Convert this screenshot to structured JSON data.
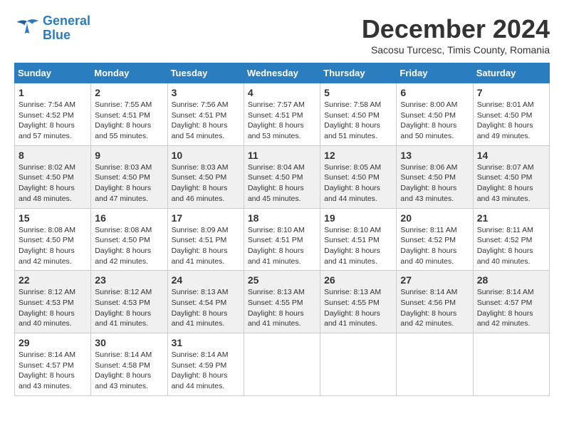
{
  "logo": {
    "line1": "General",
    "line2": "Blue"
  },
  "title": "December 2024",
  "subtitle": "Sacosu Turcesc, Timis County, Romania",
  "days_of_week": [
    "Sunday",
    "Monday",
    "Tuesday",
    "Wednesday",
    "Thursday",
    "Friday",
    "Saturday"
  ],
  "weeks": [
    [
      {
        "day": "1",
        "sunrise": "Sunrise: 7:54 AM",
        "sunset": "Sunset: 4:52 PM",
        "daylight": "Daylight: 8 hours and 57 minutes."
      },
      {
        "day": "2",
        "sunrise": "Sunrise: 7:55 AM",
        "sunset": "Sunset: 4:51 PM",
        "daylight": "Daylight: 8 hours and 55 minutes."
      },
      {
        "day": "3",
        "sunrise": "Sunrise: 7:56 AM",
        "sunset": "Sunset: 4:51 PM",
        "daylight": "Daylight: 8 hours and 54 minutes."
      },
      {
        "day": "4",
        "sunrise": "Sunrise: 7:57 AM",
        "sunset": "Sunset: 4:51 PM",
        "daylight": "Daylight: 8 hours and 53 minutes."
      },
      {
        "day": "5",
        "sunrise": "Sunrise: 7:58 AM",
        "sunset": "Sunset: 4:50 PM",
        "daylight": "Daylight: 8 hours and 51 minutes."
      },
      {
        "day": "6",
        "sunrise": "Sunrise: 8:00 AM",
        "sunset": "Sunset: 4:50 PM",
        "daylight": "Daylight: 8 hours and 50 minutes."
      },
      {
        "day": "7",
        "sunrise": "Sunrise: 8:01 AM",
        "sunset": "Sunset: 4:50 PM",
        "daylight": "Daylight: 8 hours and 49 minutes."
      }
    ],
    [
      {
        "day": "8",
        "sunrise": "Sunrise: 8:02 AM",
        "sunset": "Sunset: 4:50 PM",
        "daylight": "Daylight: 8 hours and 48 minutes."
      },
      {
        "day": "9",
        "sunrise": "Sunrise: 8:03 AM",
        "sunset": "Sunset: 4:50 PM",
        "daylight": "Daylight: 8 hours and 47 minutes."
      },
      {
        "day": "10",
        "sunrise": "Sunrise: 8:03 AM",
        "sunset": "Sunset: 4:50 PM",
        "daylight": "Daylight: 8 hours and 46 minutes."
      },
      {
        "day": "11",
        "sunrise": "Sunrise: 8:04 AM",
        "sunset": "Sunset: 4:50 PM",
        "daylight": "Daylight: 8 hours and 45 minutes."
      },
      {
        "day": "12",
        "sunrise": "Sunrise: 8:05 AM",
        "sunset": "Sunset: 4:50 PM",
        "daylight": "Daylight: 8 hours and 44 minutes."
      },
      {
        "day": "13",
        "sunrise": "Sunrise: 8:06 AM",
        "sunset": "Sunset: 4:50 PM",
        "daylight": "Daylight: 8 hours and 43 minutes."
      },
      {
        "day": "14",
        "sunrise": "Sunrise: 8:07 AM",
        "sunset": "Sunset: 4:50 PM",
        "daylight": "Daylight: 8 hours and 43 minutes."
      }
    ],
    [
      {
        "day": "15",
        "sunrise": "Sunrise: 8:08 AM",
        "sunset": "Sunset: 4:50 PM",
        "daylight": "Daylight: 8 hours and 42 minutes."
      },
      {
        "day": "16",
        "sunrise": "Sunrise: 8:08 AM",
        "sunset": "Sunset: 4:50 PM",
        "daylight": "Daylight: 8 hours and 42 minutes."
      },
      {
        "day": "17",
        "sunrise": "Sunrise: 8:09 AM",
        "sunset": "Sunset: 4:51 PM",
        "daylight": "Daylight: 8 hours and 41 minutes."
      },
      {
        "day": "18",
        "sunrise": "Sunrise: 8:10 AM",
        "sunset": "Sunset: 4:51 PM",
        "daylight": "Daylight: 8 hours and 41 minutes."
      },
      {
        "day": "19",
        "sunrise": "Sunrise: 8:10 AM",
        "sunset": "Sunset: 4:51 PM",
        "daylight": "Daylight: 8 hours and 41 minutes."
      },
      {
        "day": "20",
        "sunrise": "Sunrise: 8:11 AM",
        "sunset": "Sunset: 4:52 PM",
        "daylight": "Daylight: 8 hours and 40 minutes."
      },
      {
        "day": "21",
        "sunrise": "Sunrise: 8:11 AM",
        "sunset": "Sunset: 4:52 PM",
        "daylight": "Daylight: 8 hours and 40 minutes."
      }
    ],
    [
      {
        "day": "22",
        "sunrise": "Sunrise: 8:12 AM",
        "sunset": "Sunset: 4:53 PM",
        "daylight": "Daylight: 8 hours and 40 minutes."
      },
      {
        "day": "23",
        "sunrise": "Sunrise: 8:12 AM",
        "sunset": "Sunset: 4:53 PM",
        "daylight": "Daylight: 8 hours and 41 minutes."
      },
      {
        "day": "24",
        "sunrise": "Sunrise: 8:13 AM",
        "sunset": "Sunset: 4:54 PM",
        "daylight": "Daylight: 8 hours and 41 minutes."
      },
      {
        "day": "25",
        "sunrise": "Sunrise: 8:13 AM",
        "sunset": "Sunset: 4:55 PM",
        "daylight": "Daylight: 8 hours and 41 minutes."
      },
      {
        "day": "26",
        "sunrise": "Sunrise: 8:13 AM",
        "sunset": "Sunset: 4:55 PM",
        "daylight": "Daylight: 8 hours and 41 minutes."
      },
      {
        "day": "27",
        "sunrise": "Sunrise: 8:14 AM",
        "sunset": "Sunset: 4:56 PM",
        "daylight": "Daylight: 8 hours and 42 minutes."
      },
      {
        "day": "28",
        "sunrise": "Sunrise: 8:14 AM",
        "sunset": "Sunset: 4:57 PM",
        "daylight": "Daylight: 8 hours and 42 minutes."
      }
    ],
    [
      {
        "day": "29",
        "sunrise": "Sunrise: 8:14 AM",
        "sunset": "Sunset: 4:57 PM",
        "daylight": "Daylight: 8 hours and 43 minutes."
      },
      {
        "day": "30",
        "sunrise": "Sunrise: 8:14 AM",
        "sunset": "Sunset: 4:58 PM",
        "daylight": "Daylight: 8 hours and 43 minutes."
      },
      {
        "day": "31",
        "sunrise": "Sunrise: 8:14 AM",
        "sunset": "Sunset: 4:59 PM",
        "daylight": "Daylight: 8 hours and 44 minutes."
      },
      null,
      null,
      null,
      null
    ]
  ]
}
